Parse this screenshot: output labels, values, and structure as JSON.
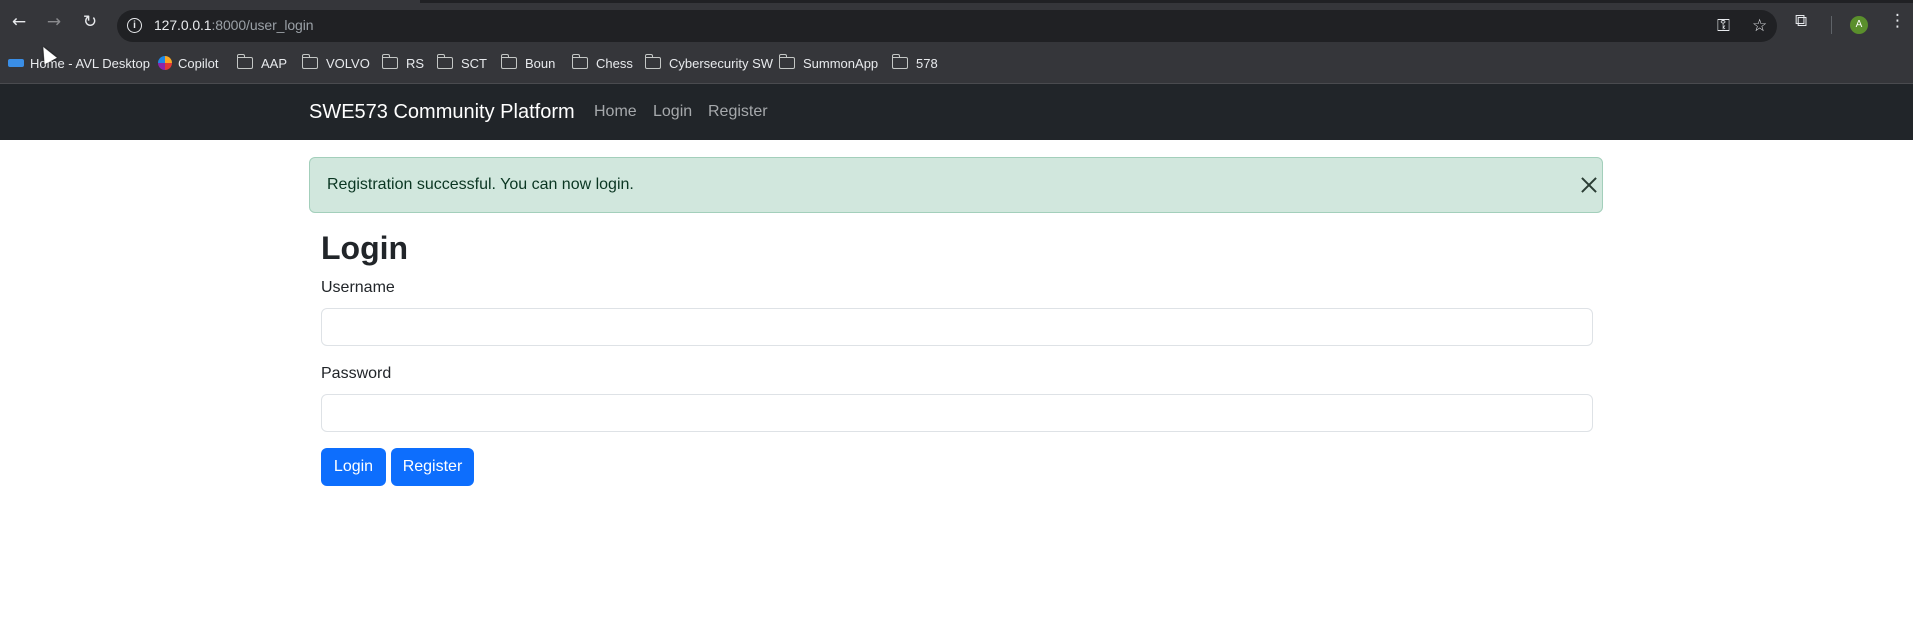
{
  "browser": {
    "url_host": "127.0.0.1",
    "url_rest": ":8000/user_login",
    "avatar_letter": "A",
    "bookmarks": [
      {
        "label": "Home - AVL Desktop",
        "type": "app"
      },
      {
        "label": "Copilot",
        "type": "copilot"
      },
      {
        "label": "AAP",
        "type": "folder"
      },
      {
        "label": "VOLVO",
        "type": "folder"
      },
      {
        "label": "RS",
        "type": "folder"
      },
      {
        "label": "SCT",
        "type": "folder"
      },
      {
        "label": "Boun",
        "type": "folder"
      },
      {
        "label": "Chess",
        "type": "folder"
      },
      {
        "label": "Cybersecurity SW",
        "type": "folder"
      },
      {
        "label": "SummonApp",
        "type": "folder"
      },
      {
        "label": "578",
        "type": "folder"
      }
    ]
  },
  "navbar": {
    "brand": "SWE573 Community Platform",
    "links": [
      "Home",
      "Login",
      "Register"
    ]
  },
  "alert": {
    "message": "Registration successful. You can now login."
  },
  "form": {
    "title": "Login",
    "username_label": "Username",
    "username_value": "",
    "password_label": "Password",
    "password_value": "",
    "login_button": "Login",
    "register_button": "Register"
  },
  "colors": {
    "navbar_bg": "#212529",
    "alert_bg": "#d1e7dd",
    "alert_text": "#0a3622",
    "primary": "#0d6efd"
  }
}
